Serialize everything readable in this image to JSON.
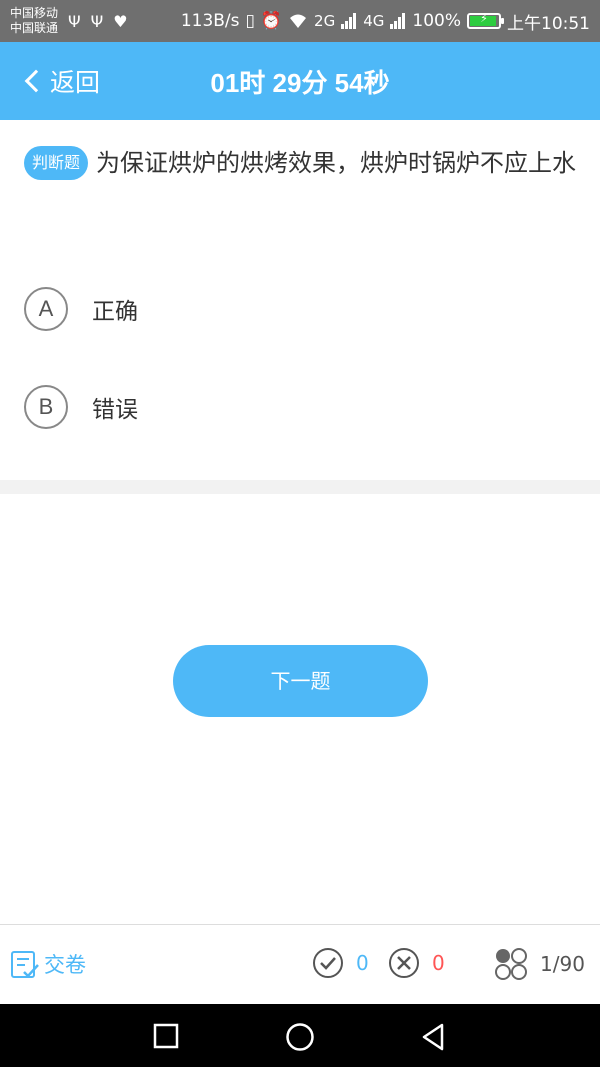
{
  "status": {
    "carrier1": "中国移动",
    "carrier2": "中国联通",
    "speed": "113B/s",
    "net2g": "2G",
    "net4g": "4G",
    "battery": "100%",
    "time": "上午10:51"
  },
  "header": {
    "back_label": "返回",
    "timer": "01时 29分 54秒"
  },
  "question": {
    "type": "判断题",
    "text": "为保证烘炉的烘烤效果，烘炉时锅炉不应上水"
  },
  "options": [
    {
      "letter": "A",
      "text": "正确"
    },
    {
      "letter": "B",
      "text": "错误"
    }
  ],
  "next_button": "下一题",
  "footer": {
    "submit_label": "交卷",
    "correct_count": "0",
    "wrong_count": "0",
    "progress": "1/90"
  },
  "colors": {
    "accent": "#4eb8f7",
    "wrong": "#ff5555"
  }
}
